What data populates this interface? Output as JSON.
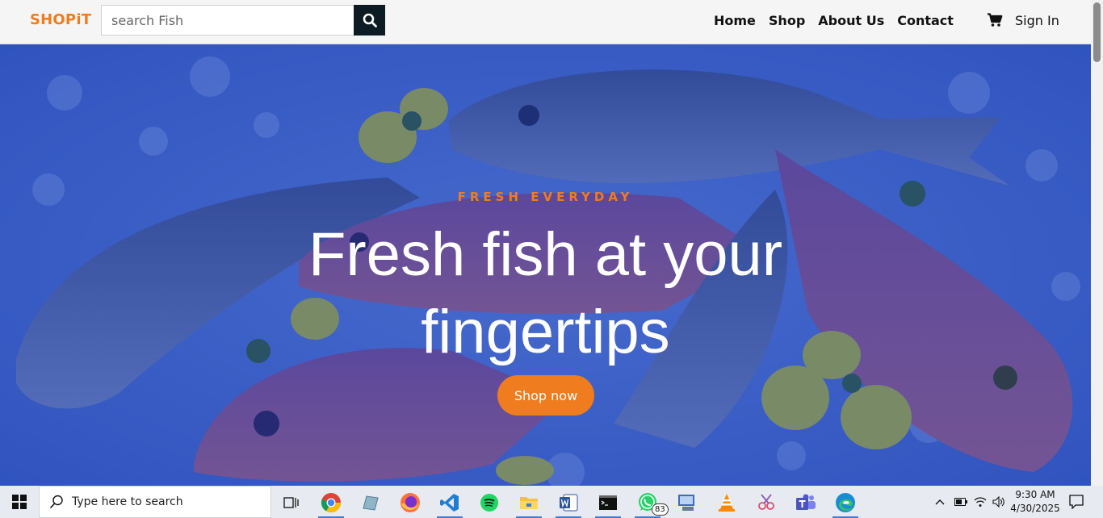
{
  "navbar": {
    "logo": "SHOPiT",
    "search_placeholder": "search Fish",
    "links": [
      "Home",
      "Shop",
      "About Us",
      "Contact"
    ],
    "signin": "Sign In"
  },
  "hero": {
    "eyebrow": "FRESH EVERYDAY",
    "headline_line1": "Fresh fish at your",
    "headline_line2": "fingertips",
    "cta": "Shop now"
  },
  "taskbar": {
    "search_placeholder": "Type here to search",
    "whatsapp_badge": "83",
    "time": "9:30 AM",
    "date": "4/30/2025",
    "apps": [
      "task-view",
      "chrome",
      "notes",
      "firefox",
      "vscode",
      "spotify",
      "file-explorer",
      "word",
      "terminal",
      "whatsapp",
      "pc-manager",
      "vlc",
      "snipping-tool",
      "teams",
      "edge"
    ]
  },
  "colors": {
    "brand": "#ef7c1f",
    "hero_overlay": "#2d4fb0",
    "search_button": "#0d1b22"
  }
}
